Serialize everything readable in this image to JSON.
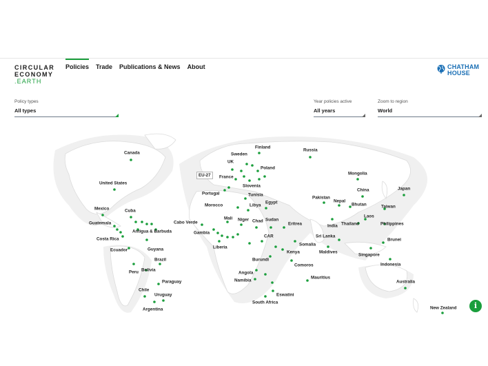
{
  "brand": {
    "line1": "CIRCULAR",
    "line2": "ECONOMY",
    "line3": ".EARTH"
  },
  "nav": [
    {
      "label": "Policies",
      "active": true
    },
    {
      "label": "Trade",
      "active": false
    },
    {
      "label": "Publications & News",
      "active": false
    },
    {
      "label": "About",
      "active": false
    }
  ],
  "partner_logo": {
    "line1": "CHATHAM",
    "line2": "HOUSE",
    "icon": "globe-icon",
    "color": "#1a6fb5"
  },
  "filters": {
    "policy_types": {
      "label": "Policy types",
      "value": "All types"
    },
    "year_active": {
      "label": "Year policies active",
      "value": "All years"
    },
    "region": {
      "label": "Zoom to region",
      "value": "World"
    }
  },
  "accent_color": "#1a9e3c",
  "map": {
    "eu_label": "EU-27",
    "countries": [
      "Canada",
      "United States",
      "Mexico",
      "Cuba",
      "Guatemala",
      "Antigua & Barbuda",
      "Costa Rica",
      "Guyana",
      "Ecuador",
      "Brazil",
      "Peru",
      "Bolivia",
      "Paraguay",
      "Chile",
      "Uruguay",
      "Argentina",
      "Finland",
      "Sweden",
      "UK",
      "Poland",
      "France",
      "Slovenia",
      "Portugal",
      "Tunisia",
      "Morocco",
      "Libya",
      "Egypt",
      "Cabo Verde",
      "Mali",
      "Niger",
      "Chad",
      "Sudan",
      "Eritrea",
      "Gambia",
      "CAR",
      "Liberia",
      "Somalia",
      "Kenya",
      "Burundi",
      "Comoros",
      "Angola",
      "Namibia",
      "Mauritius",
      "Eswatini",
      "South Africa",
      "Russia",
      "Mongolia",
      "China",
      "Japan",
      "Pakistan",
      "Nepal",
      "Bhutan",
      "Taiwan",
      "India",
      "Laos",
      "Thailand",
      "Philippines",
      "Sri Lanka",
      "Brunei",
      "Maldives",
      "Singapore",
      "Indonesia",
      "Australia",
      "New Zealand"
    ]
  },
  "info_icon": "info-icon"
}
